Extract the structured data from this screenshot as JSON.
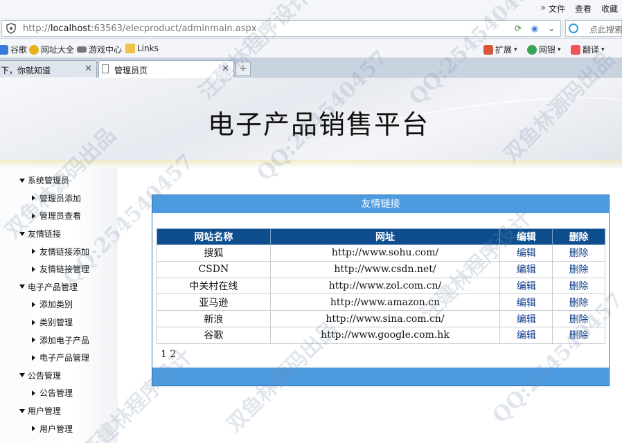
{
  "browser": {
    "menu_overflow": "»",
    "menus": [
      "文件",
      "查看",
      "收藏"
    ],
    "url_prefix": "http://",
    "url_host": "localhost",
    "url_rest": ":63563/elecproduct/adminmain.aspx",
    "search_placeholder": "点此搜索",
    "bookmarks_left": [
      "谷歌",
      "网址大全",
      "游戏中心",
      "Links"
    ],
    "bookmarks_right": [
      "扩展",
      "网银",
      "翻译"
    ],
    "tabs": [
      {
        "label": "下，你就知道",
        "active": false
      },
      {
        "label": "管理员页",
        "active": true
      }
    ],
    "newtab": "+"
  },
  "site": {
    "title": "电子产品销售平台"
  },
  "sidebar": {
    "rows": [
      {
        "label": "系统管理员",
        "type": "group"
      },
      {
        "label": "管理员添加",
        "type": "child"
      },
      {
        "label": "管理员查看",
        "type": "child"
      },
      {
        "label": "友情链接",
        "type": "group"
      },
      {
        "label": "友情链接添加",
        "type": "child"
      },
      {
        "label": "友情链接管理",
        "type": "child"
      },
      {
        "label": "电子产品管理",
        "type": "group"
      },
      {
        "label": "添加类别",
        "type": "child"
      },
      {
        "label": "类别管理",
        "type": "child"
      },
      {
        "label": "添加电子产品",
        "type": "child"
      },
      {
        "label": "电子产品管理",
        "type": "child"
      },
      {
        "label": "公告管理",
        "type": "group"
      },
      {
        "label": "公告管理",
        "type": "child"
      },
      {
        "label": "用户管理",
        "type": "group"
      },
      {
        "label": "用户管理",
        "type": "child"
      }
    ]
  },
  "panel": {
    "title": "友情链接",
    "columns": [
      "网站名称",
      "网址",
      "编辑",
      "删除"
    ],
    "rows": [
      {
        "name": "搜狐",
        "url": "http://www.sohu.com/",
        "edit": "编辑",
        "delete": "删除"
      },
      {
        "name": "CSDN",
        "url": "http://www.csdn.net/",
        "edit": "编辑",
        "delete": "删除"
      },
      {
        "name": "中关村在线",
        "url": "http://www.zol.com.cn/",
        "edit": "编辑",
        "delete": "删除"
      },
      {
        "name": "亚马逊",
        "url": "http://www.amazon.cn",
        "edit": "编辑",
        "delete": "删除"
      },
      {
        "name": "新浪",
        "url": "http://www.sina.com.cn/",
        "edit": "编辑",
        "delete": "删除"
      },
      {
        "name": "谷歌",
        "url": "http://www.google.com.hk",
        "edit": "编辑",
        "delete": "删除"
      }
    ],
    "pager": [
      "1",
      "2"
    ]
  },
  "watermark": {
    "texts": [
      "QQ:254540457",
      "双鱼林源码出品",
      "汪建林程序设计"
    ]
  },
  "colors": {
    "panel_header": "#4c9ae0",
    "table_header": "#0e4e8e",
    "link_blue": "#0b3b8a"
  }
}
